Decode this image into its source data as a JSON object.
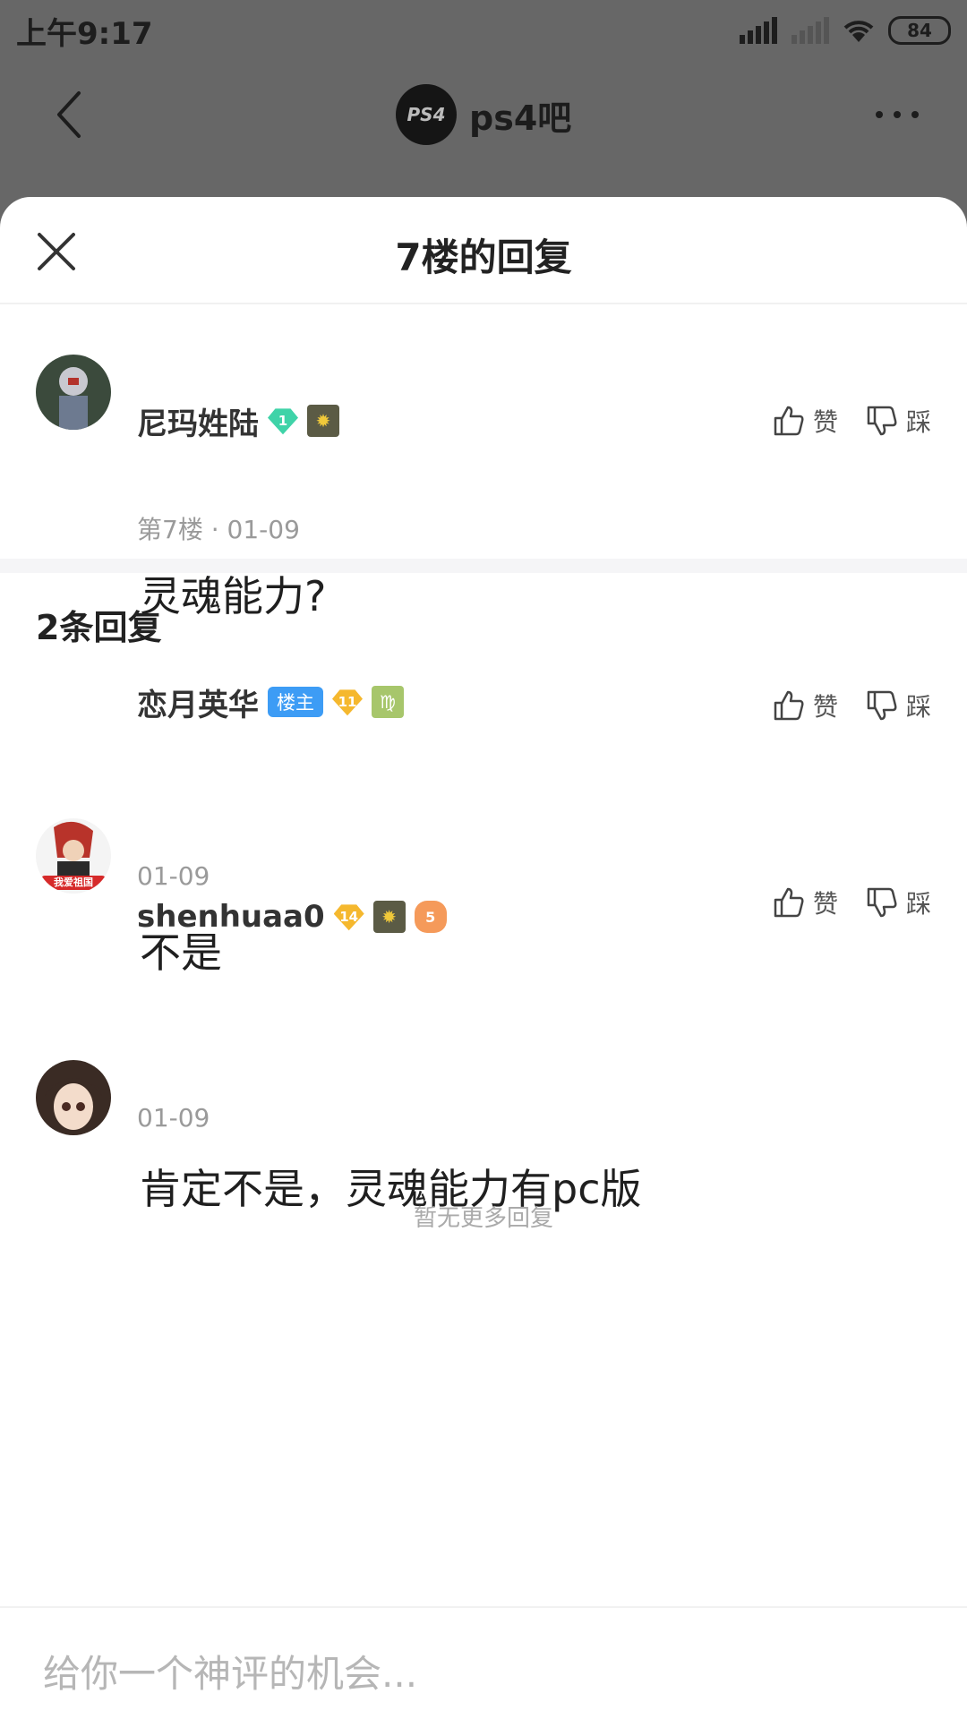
{
  "status_bar": {
    "time": "上午9:17",
    "battery": "84"
  },
  "nav": {
    "forum_name": "ps4吧",
    "forum_logo_text": "PS4"
  },
  "sheet": {
    "title": "7楼的回复"
  },
  "main_comment": {
    "username": "尼玛姓陆",
    "level": "1",
    "meta": "第7楼 · 01-09",
    "text": "灵魂能力?",
    "like_label": "赞",
    "dislike_label": "踩"
  },
  "reply_count": "2条回复",
  "replies": [
    {
      "username": "恋月英华",
      "tag": "楼主",
      "level": "11",
      "zodiac": "♍",
      "avatar_caption": "我爱祖国",
      "meta": "01-09",
      "text": "不是",
      "like_label": "赞",
      "dislike_label": "踩"
    },
    {
      "username": "shenhuaa0",
      "level": "14",
      "extra_badge": "5",
      "meta": "01-09",
      "text": "肯定不是，灵魂能力有pc版",
      "like_label": "赞",
      "dislike_label": "踩"
    }
  ],
  "no_more_text": "暂无更多回复",
  "input": {
    "placeholder": "给你一个神评的机会..."
  },
  "colors": {
    "accent_blue": "#3d9cf5",
    "gem_green": "#3fd3a8",
    "gem_gold": "#f5b82e",
    "overlay": "#676767"
  }
}
